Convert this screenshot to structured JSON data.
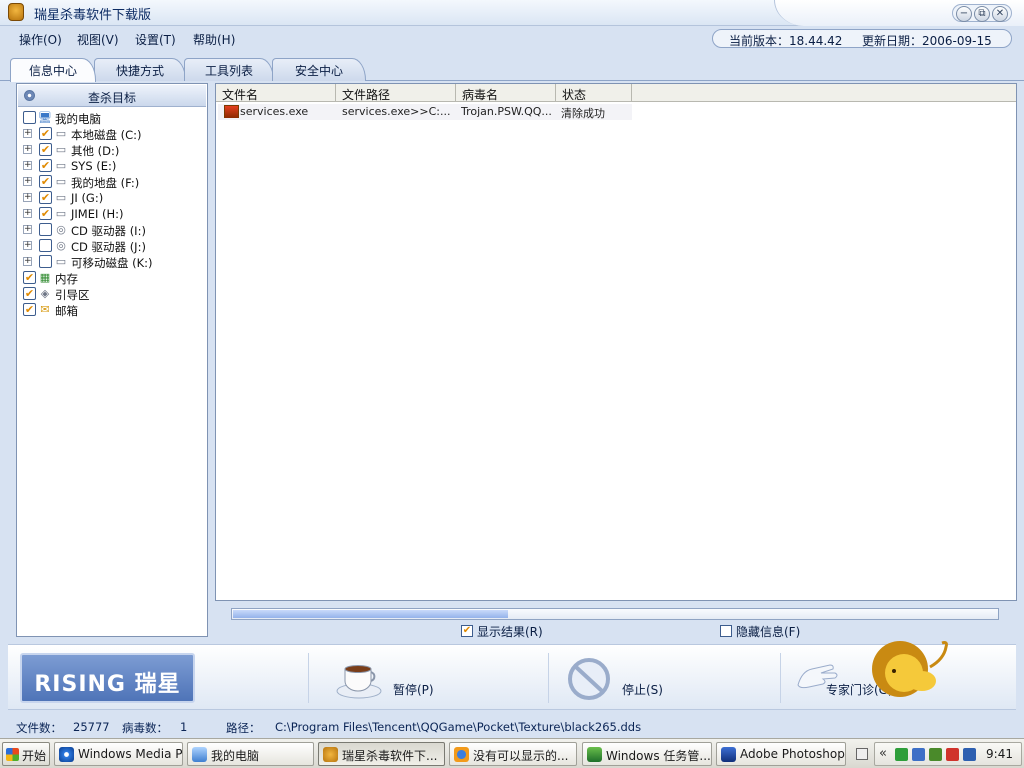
{
  "window": {
    "title": "瑞星杀毒软件下载版",
    "controls": {
      "minimize": "−",
      "restore": "⧉",
      "close": "✕"
    }
  },
  "menu": {
    "items": [
      "操作(O)",
      "视图(V)",
      "设置(T)",
      "帮助(H)"
    ],
    "version_label": "当前版本：18.44.42",
    "update_label": "更新日期：2006-09-15"
  },
  "tabs": [
    "信息中心",
    "快捷方式",
    "工具列表",
    "安全中心"
  ],
  "left_panel": {
    "header": "查杀目标",
    "tree": [
      {
        "label": "我的电脑",
        "checked": false,
        "icon": "computer-icon",
        "level": 0,
        "expander": false
      },
      {
        "label": "本地磁盘 (C:)",
        "checked": true,
        "icon": "hard-drive-icon",
        "level": 1,
        "expander": true
      },
      {
        "label": "其他 (D:)",
        "checked": true,
        "icon": "hard-drive-icon",
        "level": 1,
        "expander": true
      },
      {
        "label": "SYS (E:)",
        "checked": true,
        "icon": "hard-drive-icon",
        "level": 1,
        "expander": true
      },
      {
        "label": "我的地盘 (F:)",
        "checked": true,
        "icon": "hard-drive-icon",
        "level": 1,
        "expander": true
      },
      {
        "label": "JI (G:)",
        "checked": true,
        "icon": "hard-drive-icon",
        "level": 1,
        "expander": true
      },
      {
        "label": "JIMEI (H:)",
        "checked": true,
        "icon": "hard-drive-icon",
        "level": 1,
        "expander": true
      },
      {
        "label": "CD 驱动器 (I:)",
        "checked": false,
        "icon": "cd-drive-icon",
        "level": 1,
        "expander": true
      },
      {
        "label": "CD 驱动器 (J:)",
        "checked": false,
        "icon": "cd-drive-icon",
        "level": 1,
        "expander": true
      },
      {
        "label": "可移动磁盘 (K:)",
        "checked": false,
        "icon": "removable-disk-icon",
        "level": 1,
        "expander": true
      },
      {
        "label": "内存",
        "checked": true,
        "icon": "memory-icon",
        "level": 0,
        "expander": false
      },
      {
        "label": "引导区",
        "checked": true,
        "icon": "boot-sector-icon",
        "level": 0,
        "expander": false
      },
      {
        "label": "邮箱",
        "checked": true,
        "icon": "mail-icon",
        "level": 0,
        "expander": false
      }
    ]
  },
  "results": {
    "columns": [
      "文件名",
      "文件路径",
      "病毒名",
      "状态"
    ],
    "rows": [
      {
        "file": "services.exe",
        "path": "services.exe>>C:...",
        "virus": "Trojan.PSW.QQ...",
        "status": "清除成功"
      }
    ]
  },
  "progress": {
    "fraction": 0.36
  },
  "options": {
    "show_results": {
      "label": "显示结果(R)",
      "checked": true
    },
    "hide_info": {
      "label": "隐藏信息(F)",
      "checked": false
    }
  },
  "actions": {
    "logo_text": "RISING 瑞星",
    "pause": "暂停(P)",
    "stop": "停止(S)",
    "expert": "专家门诊(G)"
  },
  "status": {
    "files_label": "文件数：",
    "files_value": "25777",
    "viruses_label": "病毒数：",
    "viruses_value": "1",
    "path_label": "路径：",
    "path_value": "C:\\Program Files\\Tencent\\QQGame\\Pocket\\Texture\\black265.dds"
  },
  "taskbar": {
    "start": "开始",
    "buttons": [
      {
        "label": "Windows Media Pl...",
        "active": false
      },
      {
        "label": "我的电脑",
        "active": false
      },
      {
        "label": "瑞星杀毒软件下...",
        "active": true
      },
      {
        "label": "没有可以显示的...",
        "active": false
      },
      {
        "label": "Windows 任务管...",
        "active": false
      },
      {
        "label": "Adobe Photoshop",
        "active": false
      }
    ],
    "chevron": "«",
    "clock": "9:41"
  },
  "colors": {
    "accent": "#0a1e44",
    "progress_fill": "#94b3ea",
    "check_mark": "#e08a00"
  }
}
